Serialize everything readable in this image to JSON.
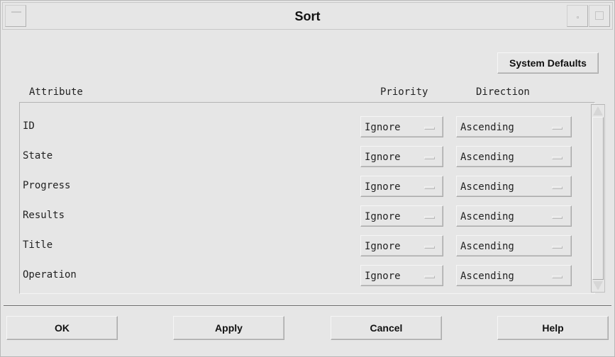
{
  "window": {
    "title": "Sort"
  },
  "toolbar": {
    "system_defaults_label": "System Defaults"
  },
  "columns": {
    "attribute": "Attribute",
    "priority": "Priority",
    "direction": "Direction"
  },
  "rows": [
    {
      "attribute": "ID",
      "priority": "Ignore",
      "direction": "Ascending"
    },
    {
      "attribute": "State",
      "priority": "Ignore",
      "direction": "Ascending"
    },
    {
      "attribute": "Progress",
      "priority": "Ignore",
      "direction": "Ascending"
    },
    {
      "attribute": "Results",
      "priority": "Ignore",
      "direction": "Ascending"
    },
    {
      "attribute": "Title",
      "priority": "Ignore",
      "direction": "Ascending"
    },
    {
      "attribute": "Operation",
      "priority": "Ignore",
      "direction": "Ascending"
    }
  ],
  "buttons": {
    "ok": "OK",
    "apply": "Apply",
    "cancel": "Cancel",
    "help": "Help"
  },
  "icons": {
    "window_menu": "window-menu-icon",
    "minimize": "minimize-icon",
    "maximize": "maximize-icon",
    "option_indicator": "option-menu-indicator-icon",
    "scroll_up": "scroll-up-arrow-icon",
    "scroll_down": "scroll-down-arrow-icon"
  },
  "colors": {
    "background": "#ebebeb",
    "text": "#222222",
    "bevel_light": "#f6f6f6",
    "bevel_dark": "#a8a8a8"
  }
}
